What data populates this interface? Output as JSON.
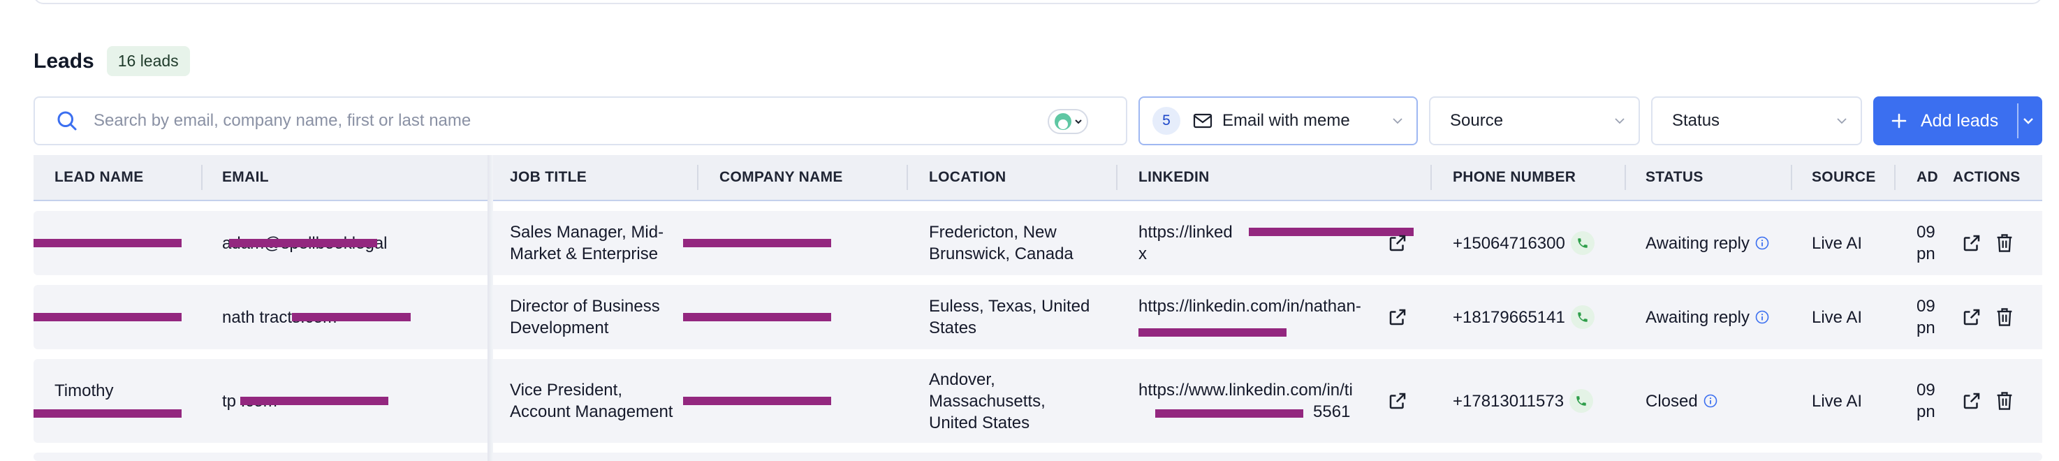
{
  "header": {
    "title": "Leads",
    "badge": "16 leads"
  },
  "search": {
    "placeholder": "Search by email, company name, first or last name"
  },
  "filters": {
    "campaign": {
      "count": "5",
      "label": "Email with meme"
    },
    "source": {
      "label": "Source"
    },
    "status": {
      "label": "Status"
    }
  },
  "add_button": {
    "label": "Add leads"
  },
  "colors": {
    "accent": "#3b6ff0",
    "redaction": "#93277f",
    "phone_green": "#2e9e4a",
    "info_blue": "#3b6ff0"
  },
  "table": {
    "columns": {
      "lead_name": "LEAD NAME",
      "email": "EMAIL",
      "job_title": "JOB TITLE",
      "company_name": "COMPANY NAME",
      "location": "LOCATION",
      "linkedin": "LINKEDIN",
      "phone": "PHONE NUMBER",
      "status": "STATUS",
      "source": "SOURCE",
      "added": "AD",
      "actions": "ACTIONS"
    },
    "rows": [
      {
        "lead_name": "",
        "email_visible": "adam@spellbooklegal",
        "job_title_1": "Sales Manager, Mid-",
        "job_title_2": "Market & Enterprise",
        "location_1": "Fredericton, New",
        "location_2": "Brunswick, Canada",
        "location_3": "",
        "linkedin_1": "https://linked",
        "linkedin_2": "x",
        "phone": "+15064716300",
        "status": "Awaiting reply",
        "source": "Live AI",
        "added_1": "09",
        "added_2": "pn"
      },
      {
        "lead_name": "",
        "email_visible": "nath                    tracts.com",
        "job_title_1": "Director of Business",
        "job_title_2": "Development",
        "location_1": "Euless, Texas, United",
        "location_2": "States",
        "location_3": "",
        "linkedin_1": "https://linkedin.com/in/nathan-",
        "linkedin_2": "",
        "phone": "+18179665141",
        "status": "Awaiting reply",
        "source": "Live AI",
        "added_1": "09",
        "added_2": "pn"
      },
      {
        "lead_name": "Timothy",
        "email_visible": "tp                              .com",
        "job_title_1": "Vice President,",
        "job_title_2": "Account Management",
        "location_1": "Andover,",
        "location_2": "Massachusetts,",
        "location_3": "United States",
        "linkedin_1": "https://www.linkedin.com/in/ti",
        "linkedin_2": "5561",
        "phone": "+17813011573",
        "status": "Closed",
        "source": "Live AI",
        "added_1": "09",
        "added_2": "pn"
      }
    ]
  }
}
